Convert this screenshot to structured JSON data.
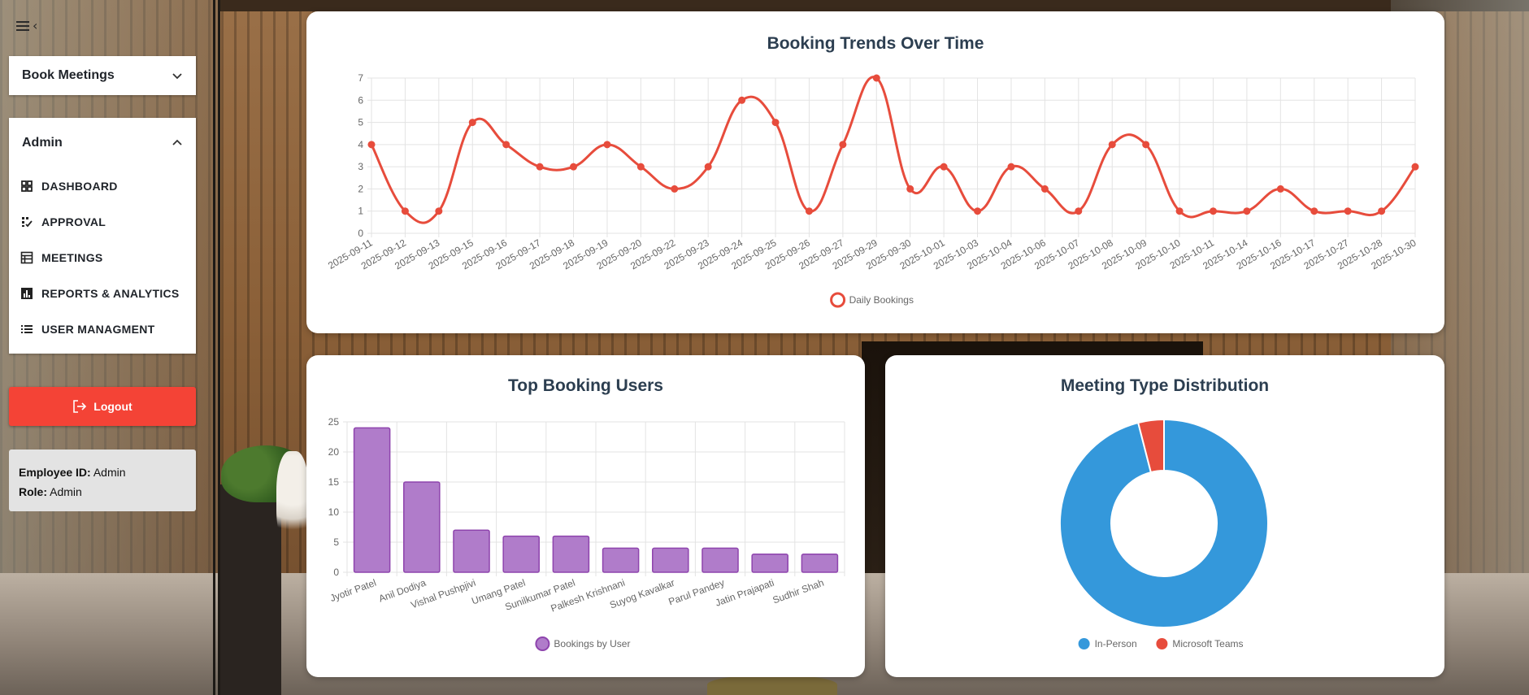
{
  "sidebar": {
    "book_meetings": "Book Meetings",
    "admin": "Admin",
    "items": [
      {
        "label": "DASHBOARD",
        "icon": "grid-icon"
      },
      {
        "label": "APPROVAL",
        "icon": "approval-icon"
      },
      {
        "label": "MEETINGS",
        "icon": "table-icon"
      },
      {
        "label": "REPORTS & ANALYTICS",
        "icon": "analytics-icon"
      },
      {
        "label": "USER MANAGMENT",
        "icon": "list-icon"
      }
    ],
    "logout": "Logout",
    "employee_label": "Employee ID:",
    "employee_value": "Admin",
    "role_label": "Role:",
    "role_value": "Admin"
  },
  "colors": {
    "line": "#e74c3c",
    "bar_fill": "#b07cca",
    "bar_stroke": "#8e44ad",
    "in_person": "#3498db",
    "teams": "#e74c3c",
    "logout": "#f44336"
  },
  "chart_data": [
    {
      "type": "line",
      "title": "Booking Trends Over Time",
      "x": [
        "2025-09-11",
        "2025-09-12",
        "2025-09-13",
        "2025-09-15",
        "2025-09-16",
        "2025-09-17",
        "2025-09-18",
        "2025-09-19",
        "2025-09-20",
        "2025-09-22",
        "2025-09-23",
        "2025-09-24",
        "2025-09-25",
        "2025-09-26",
        "2025-09-27",
        "2025-09-29",
        "2025-09-30",
        "2025-10-01",
        "2025-10-03",
        "2025-10-04",
        "2025-10-06",
        "2025-10-07",
        "2025-10-08",
        "2025-10-09",
        "2025-10-10",
        "2025-10-11",
        "2025-10-14",
        "2025-10-16",
        "2025-10-17",
        "2025-10-27",
        "2025-10-28",
        "2025-10-30"
      ],
      "series": [
        {
          "name": "Daily Bookings",
          "values": [
            4,
            1,
            1,
            5,
            4,
            3,
            3,
            4,
            3,
            2,
            3,
            6,
            5,
            1,
            4,
            7,
            2,
            3,
            1,
            3,
            2,
            1,
            4,
            4,
            1,
            1,
            1,
            2,
            1,
            1,
            1,
            3
          ]
        }
      ],
      "ylim": [
        0,
        7
      ],
      "yticks": [
        0,
        1,
        2,
        3,
        4,
        5,
        6,
        7
      ],
      "grid": true,
      "legend": "bottom"
    },
    {
      "type": "bar",
      "title": "Top Booking Users",
      "categories": [
        "Jyotir Patel",
        "Anil Dodiya",
        "Vishal Pushpjivi",
        "Umang Patel",
        "Sunilkumar Patel",
        "Palkesh Krishnani",
        "Suyog Kavalkar",
        "Parul Pandey",
        "Jatin Prajapati",
        "Sudhir Shah"
      ],
      "series": [
        {
          "name": "Bookings by User",
          "values": [
            24,
            15,
            7,
            6,
            6,
            4,
            4,
            4,
            3,
            3
          ]
        }
      ],
      "ylim": [
        0,
        25
      ],
      "yticks": [
        0,
        5,
        10,
        15,
        20,
        25
      ],
      "grid": true,
      "legend": "bottom"
    },
    {
      "type": "pie",
      "title": "Meeting Type Distribution",
      "labels": [
        "In-Person",
        "Microsoft Teams"
      ],
      "values": [
        96,
        4
      ],
      "legend": "bottom"
    }
  ]
}
